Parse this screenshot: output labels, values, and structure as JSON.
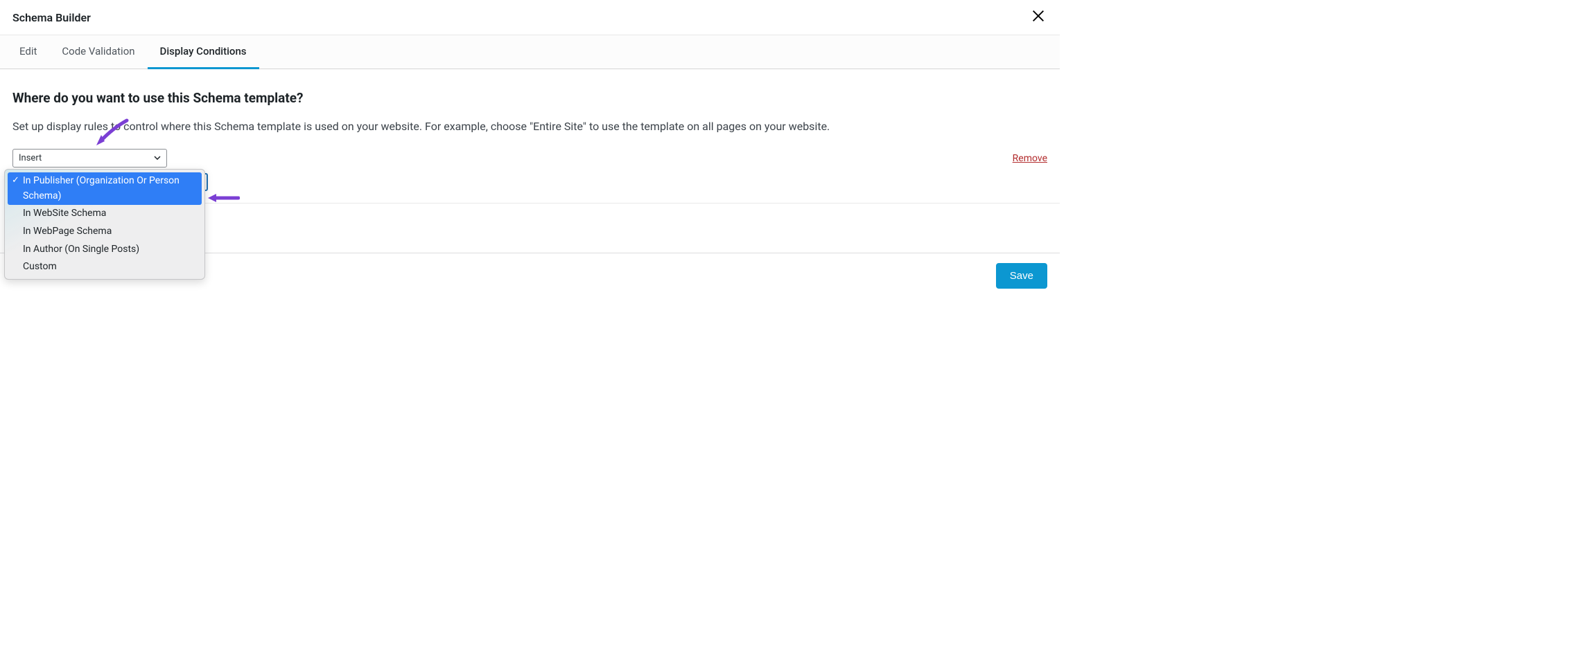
{
  "header": {
    "title": "Schema Builder"
  },
  "tabs": {
    "edit": "Edit",
    "code_validation": "Code Validation",
    "display_conditions": "Display Conditions"
  },
  "content": {
    "question": "Where do you want to use this Schema template?",
    "description": "Set up display rules to control where this Schema template is used on your website. For example, choose \"Entire Site\" to use the template on all pages on your website.",
    "select_label": "Insert",
    "remove": "Remove"
  },
  "dropdown": {
    "items": [
      "In Publisher (Organization Or Person Schema)",
      "In WebSite Schema",
      "In WebPage Schema",
      "In Author (On Single Posts)",
      "Custom"
    ]
  },
  "footer": {
    "save": "Save"
  }
}
